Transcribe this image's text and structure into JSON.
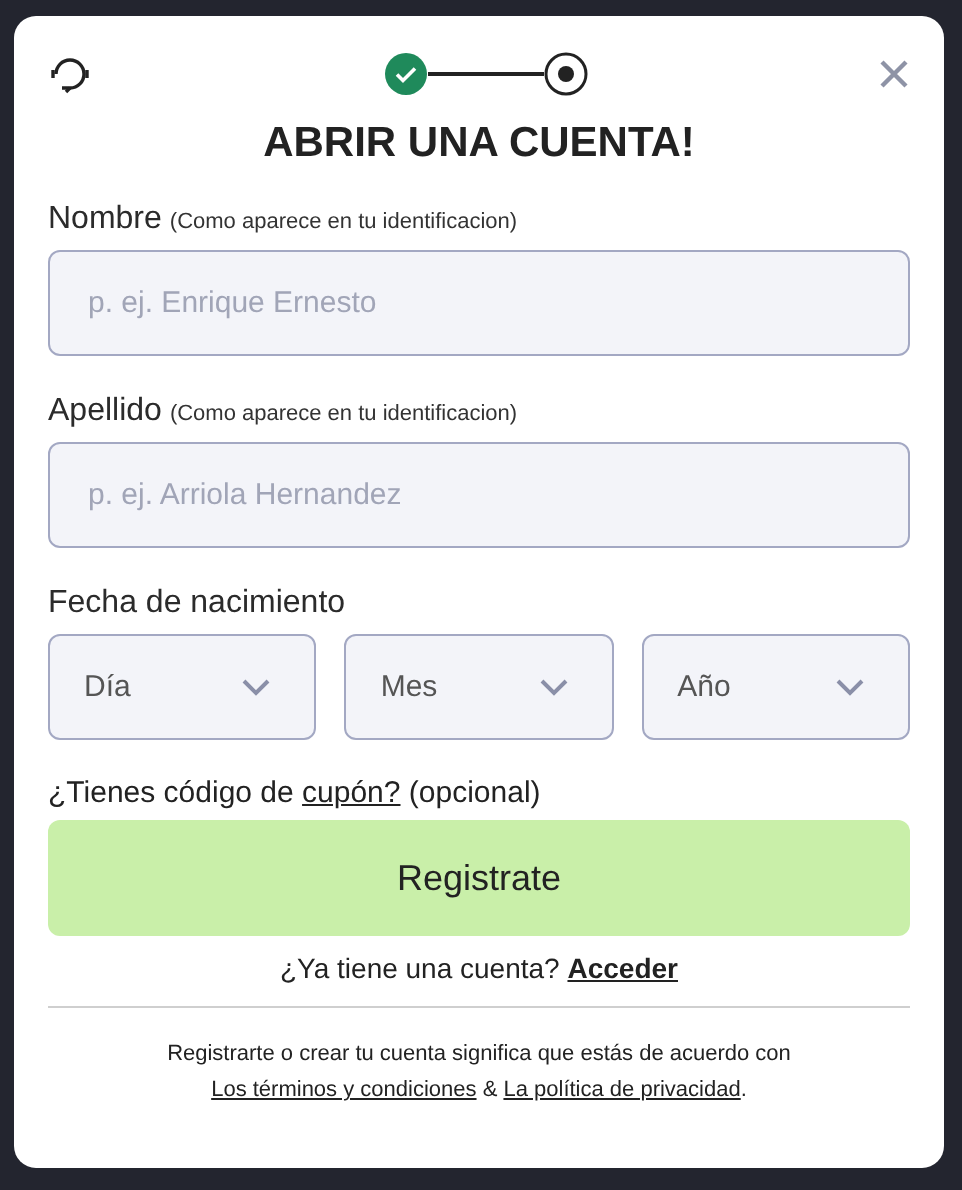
{
  "steps": [
    {
      "completed": true,
      "selected": false
    },
    {
      "completed": false,
      "selected": true
    }
  ],
  "title": "ABRIR UNA CUENTA!",
  "fields": [
    {
      "label": "Nombre",
      "hint": "(Como aparece en tu identificacion)",
      "placeholder": "p. ej. Enrique Ernesto"
    },
    {
      "label": "Apellido",
      "hint": "(Como aparece en tu identificacion)",
      "placeholder": "p. ej. Arriola Hernandez"
    }
  ],
  "birth_date": {
    "label": "Fecha de nacimiento",
    "selects": [
      "Día",
      "Mes",
      "Año"
    ]
  },
  "coupon": {
    "prefix": "¿Tienes código de",
    "link": "cupón?",
    "suffix": "(opcional)"
  },
  "submit_button": "Registrate",
  "login": {
    "prompt": "¿Ya tiene una cuenta?",
    "link": "Acceder"
  },
  "terms": {
    "prefix": "Registrarte o crear tu cuenta significa que estás de acuerdo con",
    "link_1": "Los términos y condiciones",
    "middle": "&",
    "link_2": "La política de privacidad",
    "suffix": "."
  }
}
